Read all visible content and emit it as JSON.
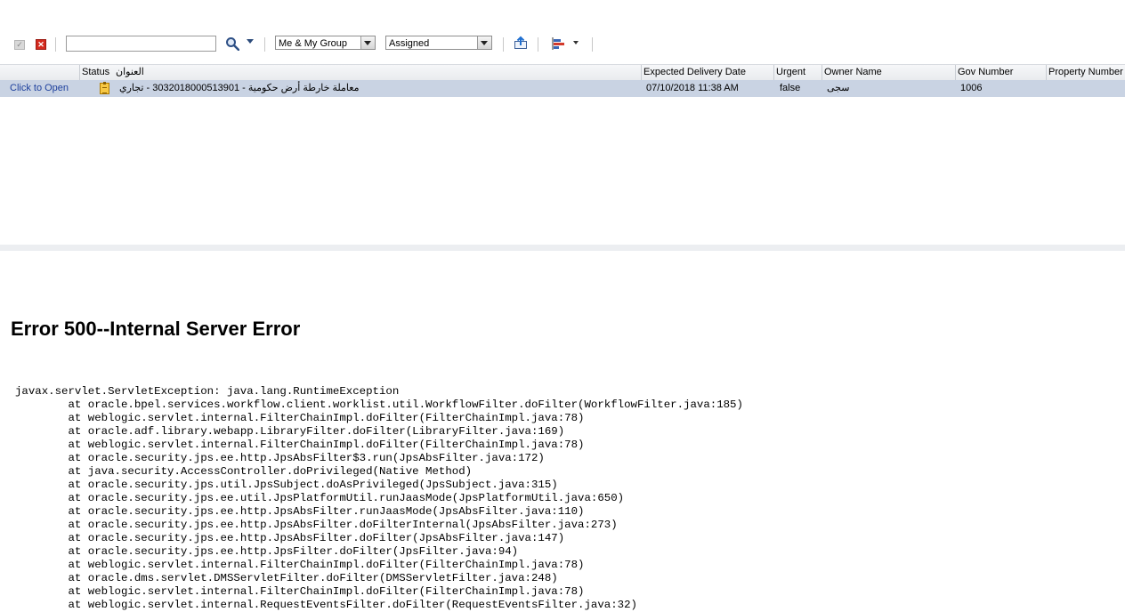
{
  "toolbar": {
    "search_value": "",
    "assignee_filter": "Me & My Group",
    "state_filter": "Assigned",
    "icons": [
      "check-icon",
      "delete-icon",
      "search-icon",
      "export-icon",
      "bar-chart-icon"
    ]
  },
  "table": {
    "columns": {
      "status": "Status",
      "title": "العنوان",
      "expected_delivery": "Expected Delivery Date",
      "urgent": "Urgent",
      "owner_name": "Owner Name",
      "gov_number": "Gov Number",
      "property_number": "Property Number"
    },
    "rows": [
      {
        "open_link": "Click to Open",
        "title": "معاملة خارطة أرض حكومية - 3032018000513901 - تجاري",
        "expected_delivery": "07/10/2018 11:38 AM",
        "urgent": "false",
        "owner_name": "سجى",
        "gov_number": "1006",
        "property_number": ""
      }
    ]
  },
  "error": {
    "title": "Error 500--Internal Server Error",
    "trace": "javax.servlet.ServletException: java.lang.RuntimeException\n\tat oracle.bpel.services.workflow.client.worklist.util.WorkflowFilter.doFilter(WorkflowFilter.java:185)\n\tat weblogic.servlet.internal.FilterChainImpl.doFilter(FilterChainImpl.java:78)\n\tat oracle.adf.library.webapp.LibraryFilter.doFilter(LibraryFilter.java:169)\n\tat weblogic.servlet.internal.FilterChainImpl.doFilter(FilterChainImpl.java:78)\n\tat oracle.security.jps.ee.http.JpsAbsFilter$3.run(JpsAbsFilter.java:172)\n\tat java.security.AccessController.doPrivileged(Native Method)\n\tat oracle.security.jps.util.JpsSubject.doAsPrivileged(JpsSubject.java:315)\n\tat oracle.security.jps.ee.util.JpsPlatformUtil.runJaasMode(JpsPlatformUtil.java:650)\n\tat oracle.security.jps.ee.http.JpsAbsFilter.runJaasMode(JpsAbsFilter.java:110)\n\tat oracle.security.jps.ee.http.JpsAbsFilter.doFilterInternal(JpsAbsFilter.java:273)\n\tat oracle.security.jps.ee.http.JpsAbsFilter.doFilter(JpsAbsFilter.java:147)\n\tat oracle.security.jps.ee.http.JpsFilter.doFilter(JpsFilter.java:94)\n\tat weblogic.servlet.internal.FilterChainImpl.doFilter(FilterChainImpl.java:78)\n\tat oracle.dms.servlet.DMSServletFilter.doFilter(DMSServletFilter.java:248)\n\tat weblogic.servlet.internal.FilterChainImpl.doFilter(FilterChainImpl.java:78)\n\tat weblogic.servlet.internal.RequestEventsFilter.doFilter(RequestEventsFilter.java:32)"
  }
}
